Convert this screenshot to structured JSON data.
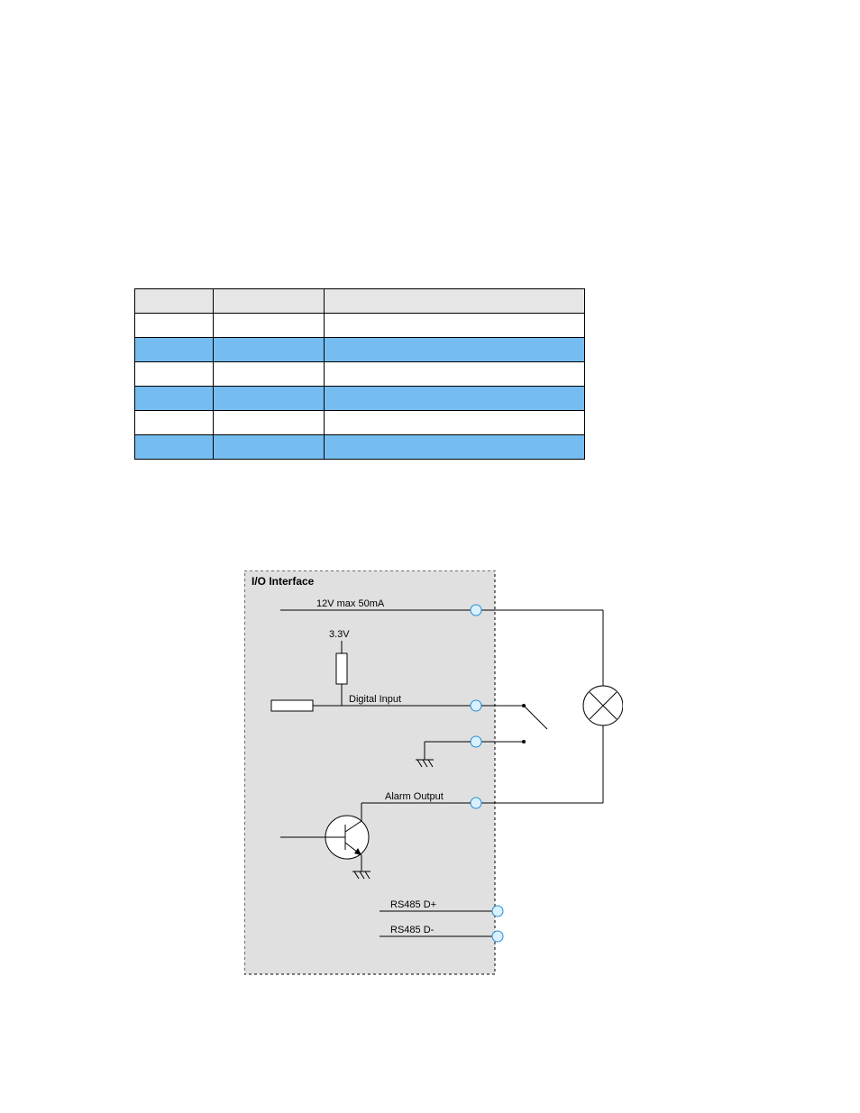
{
  "table": {
    "rows": [
      {
        "c1": "",
        "c2": "",
        "c3": ""
      },
      {
        "c1": "",
        "c2": "",
        "c3": ""
      },
      {
        "c1": "",
        "c2": "",
        "c3": ""
      },
      {
        "c1": "",
        "c2": "",
        "c3": ""
      },
      {
        "c1": "",
        "c2": "",
        "c3": ""
      },
      {
        "c1": "",
        "c2": "",
        "c3": ""
      },
      {
        "c1": "",
        "c2": "",
        "c3": ""
      }
    ]
  },
  "diagram": {
    "title": "I/O Interface",
    "power_label": "12V max 50mA",
    "logic_label": "3.3V",
    "input_label": "Digital Input",
    "output_label": "Alarm Output",
    "rs485_plus": "RS485 D+",
    "rs485_minus": "RS485 D-"
  }
}
